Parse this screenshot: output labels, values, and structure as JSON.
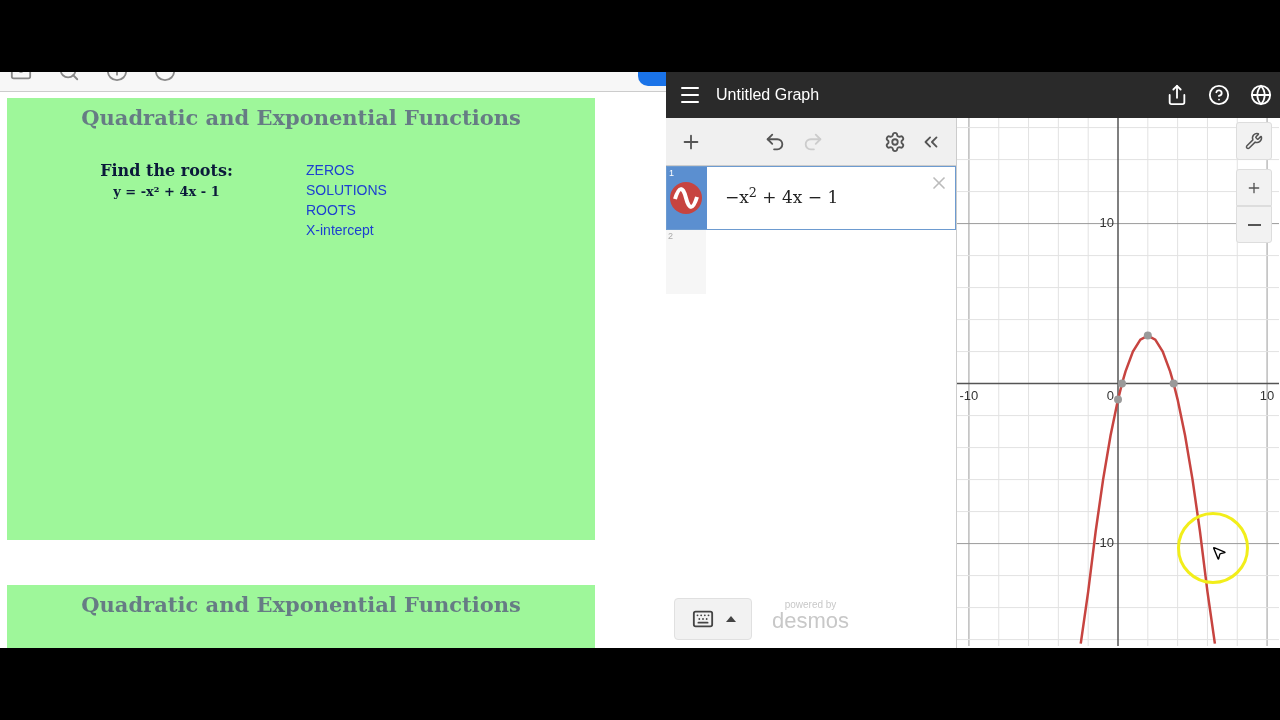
{
  "pdf_viewer": {
    "slides": [
      {
        "title": "Quadratic and Exponential Functions",
        "prompt": "Find the roots:",
        "equation": "y = -x² + 4x - 1",
        "terms": [
          "ZEROS",
          "SOLUTIONS",
          "ROOTS",
          "X-intercept"
        ]
      },
      {
        "title": "Quadratic and Exponential Functions"
      }
    ]
  },
  "desmos": {
    "title": "Untitled Graph",
    "expressions": [
      {
        "number": "1",
        "latex": "−x$^{2}$ + 4x − 1",
        "color": "#c74440"
      },
      {
        "number": "2"
      }
    ],
    "powered_by": "powered by",
    "brand": "desmos",
    "origin_label": "0",
    "chart_data": {
      "type": "line",
      "grid": true,
      "xlim": [
        -10.8,
        10.8
      ],
      "ylim": [
        -16.4,
        16.6
      ],
      "xticks": [
        -10,
        10
      ],
      "yticks": [
        -10,
        10
      ],
      "x": [
        -2.5,
        -2,
        -1.5,
        -1,
        -0.5,
        0,
        0.268,
        0.5,
        1,
        1.5,
        2,
        2.5,
        3,
        3.5,
        3.732,
        4,
        4.5,
        5,
        5.5,
        6,
        6.5
      ],
      "series": [
        {
          "color": "#c74440",
          "values": [
            -16.25,
            -13,
            -9.25,
            -6,
            -3.25,
            -1,
            0,
            0.75,
            2,
            2.75,
            3,
            2.75,
            2,
            0.75,
            0,
            -1,
            -3.25,
            -6,
            -9.25,
            -13,
            -16.25
          ]
        },
        {
          "type": "scatter",
          "color": "#9a9a9a",
          "values": [
            null,
            null,
            null,
            null,
            null,
            -1,
            0,
            null,
            null,
            null,
            3,
            null,
            null,
            null,
            0,
            null,
            null,
            null,
            null,
            null,
            null
          ]
        }
      ]
    }
  }
}
